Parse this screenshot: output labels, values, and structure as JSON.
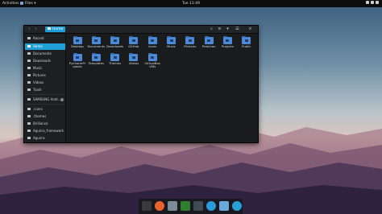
{
  "topbar": {
    "activities": "Activities",
    "app_menu": "Files ▾",
    "clock": "Tue 11:49"
  },
  "window": {
    "breadcrumb": "Home",
    "sidebar": {
      "items": [
        {
          "label": "Recent",
          "icon": "clock-icon"
        },
        {
          "label": "Home",
          "icon": "home-icon",
          "selected": true
        },
        {
          "label": "Documents",
          "icon": "document-icon"
        },
        {
          "label": "Downloads",
          "icon": "download-icon"
        },
        {
          "label": "Music",
          "icon": "music-icon"
        },
        {
          "label": "Pictures",
          "icon": "picture-icon"
        },
        {
          "label": "Videos",
          "icon": "video-icon"
        },
        {
          "label": "Trash",
          "icon": "trash-icon"
        },
        {
          "label": "SAMSUNG Andr...",
          "icon": "phone-icon"
        },
        {
          "label": ".icons",
          "icon": "folder-icon"
        },
        {
          "label": ".themes",
          "icon": "folder-icon"
        },
        {
          "label": "Brilliance",
          "icon": "folder-icon"
        },
        {
          "label": "Aquirra_framework",
          "icon": "folder-icon"
        },
        {
          "label": "Aquirra",
          "icon": "folder-icon"
        }
      ]
    },
    "files": [
      {
        "label": "Desktop",
        "icon": "desktop-folder-icon"
      },
      {
        "label": "Documents",
        "icon": "documents-folder-icon"
      },
      {
        "label": "Downloads",
        "icon": "downloads-folder-icon"
      },
      {
        "label": "GitHub",
        "icon": "github-folder-icon"
      },
      {
        "label": "Icons",
        "icon": "folder-icon"
      },
      {
        "label": "Music",
        "icon": "music-folder-icon"
      },
      {
        "label": "Pictures",
        "icon": "pictures-folder-icon"
      },
      {
        "label": "Pratchan",
        "icon": "folder-icon"
      },
      {
        "label": "Projects",
        "icon": "folder-icon"
      },
      {
        "label": "Public",
        "icon": "public-folder-icon"
      },
      {
        "label": "PycharmProjects",
        "icon": "folder-icon"
      },
      {
        "label": "Templates",
        "icon": "templates-folder-icon"
      },
      {
        "label": "Themes",
        "icon": "folder-icon"
      },
      {
        "label": "Videos",
        "icon": "videos-folder-icon"
      },
      {
        "label": "VirtualBox VMs",
        "icon": "folder-icon"
      }
    ]
  },
  "dock": {
    "items": [
      {
        "name": "show-apps-icon",
        "color": "#3a3a3e"
      },
      {
        "name": "firefox-icon",
        "color": "#e8632b"
      },
      {
        "name": "files-icon",
        "color": "#7d8b99"
      },
      {
        "name": "terminal-icon",
        "color": "#2e7d32"
      },
      {
        "name": "monitor-icon",
        "color": "#424a55"
      },
      {
        "name": "power-icon",
        "color": "#2a9ad8"
      },
      {
        "name": "mail-icon",
        "color": "#6aa8d8"
      },
      {
        "name": "telegram-icon",
        "color": "#2aa1d6"
      }
    ]
  },
  "colors": {
    "accent": "#1f9fd6",
    "folder": "#4b8ad8",
    "window_bg": "#1a1b1d"
  }
}
